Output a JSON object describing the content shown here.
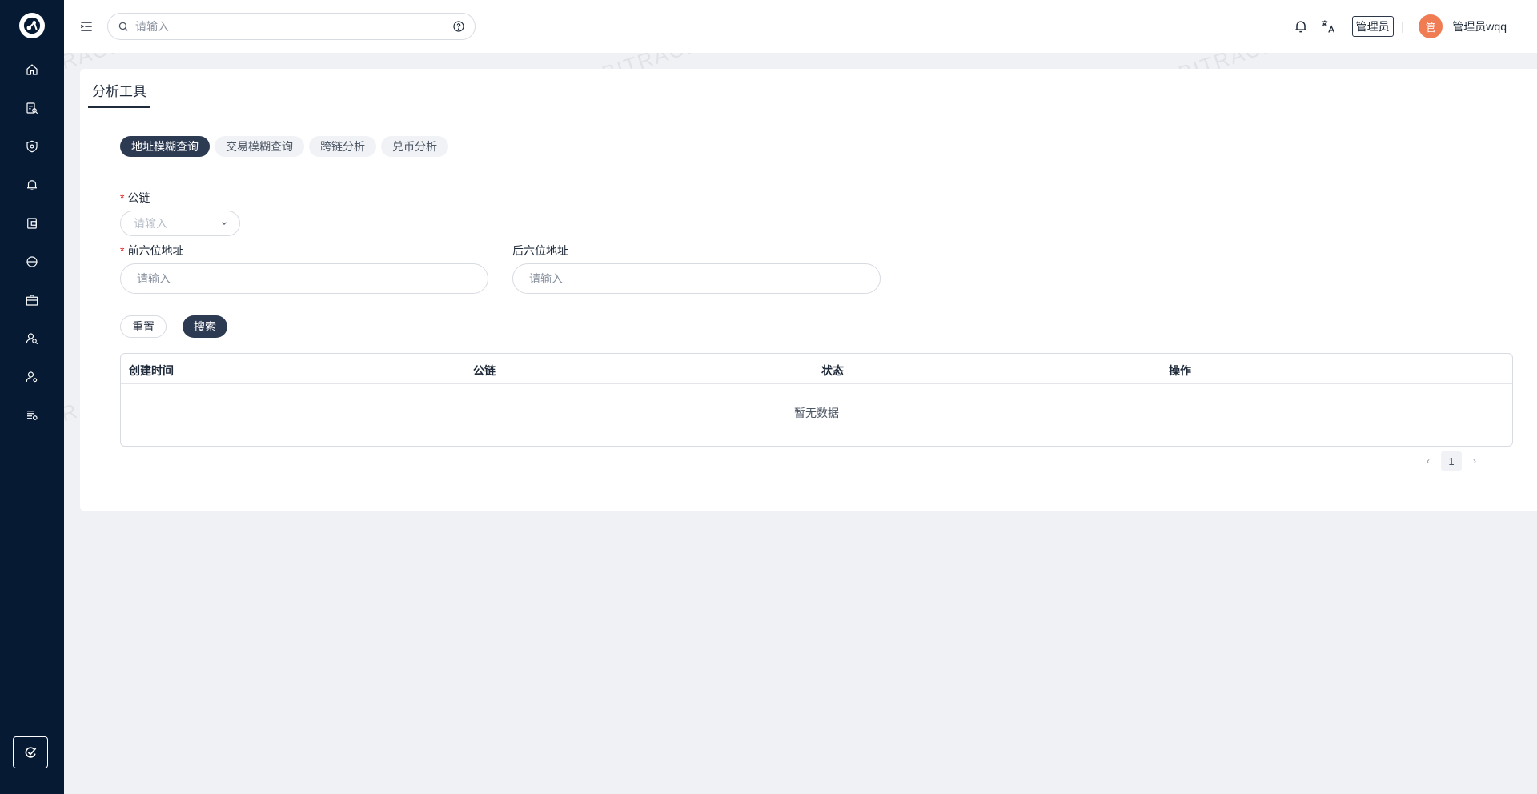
{
  "watermark": "BITRACE",
  "sidebar": {
    "icons": [
      "home-icon",
      "report-search-icon",
      "shield-icon",
      "bell-icon",
      "wallet-icon",
      "eye-icon",
      "briefcase-icon",
      "user-search-icon",
      "user-settings-icon",
      "list-settings-icon"
    ],
    "active_index": 6,
    "bottom_icon": "refresh-check-icon"
  },
  "header": {
    "search_placeholder": "请输入",
    "role_badge": "管理员",
    "separator": "|",
    "avatar_text": "管",
    "username": "管理员wqq"
  },
  "page": {
    "tab_label": "分析工具"
  },
  "segments": [
    {
      "label": "地址模糊查询",
      "active": true
    },
    {
      "label": "交易模糊查询",
      "active": false
    },
    {
      "label": "跨链分析",
      "active": false
    },
    {
      "label": "兑币分析",
      "active": false
    }
  ],
  "form": {
    "required_mark": "*",
    "chain_label": "公链",
    "chain_placeholder": "请输入",
    "prefix_label": "前六位地址",
    "prefix_placeholder": "请输入",
    "suffix_label": "后六位地址",
    "suffix_placeholder": "请输入",
    "reset_label": "重置",
    "search_label": "搜索"
  },
  "table": {
    "columns": [
      "创建时间",
      "公链",
      "状态",
      "操作"
    ],
    "empty_text": "暂无数据"
  },
  "pagination": {
    "prev": "‹",
    "current": "1",
    "next": "›"
  },
  "colors": {
    "sidebar_bg": "#071a33",
    "accent": "#2c3a52",
    "avatar_bg": "#f07c54",
    "required": "#e02020"
  }
}
